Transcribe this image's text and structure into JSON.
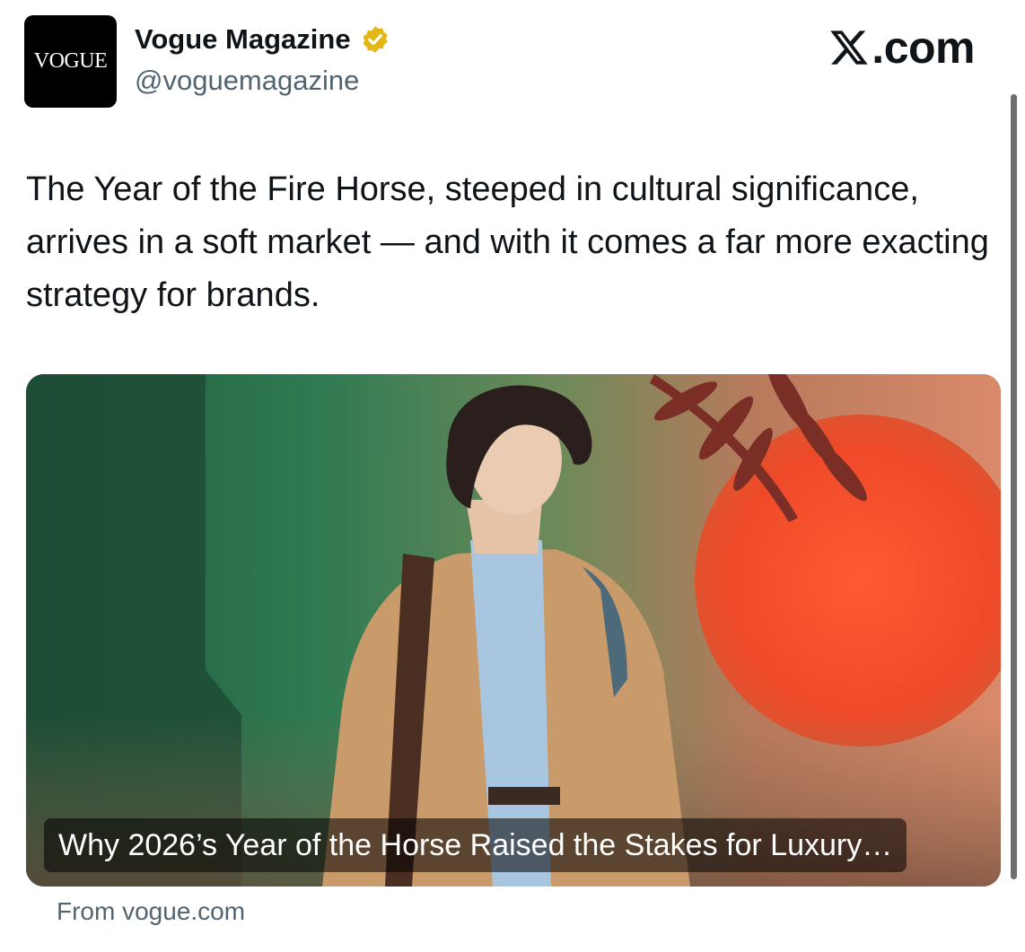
{
  "account": {
    "avatar_text": "VOGUE",
    "name": "Vogue Magazine",
    "handle": "@voguemagazine",
    "verified_badge": "gold-verified-check"
  },
  "site_label": ".com",
  "site_icon": "x-logo",
  "tweet": {
    "text": "The Year of the Fire Horse, steeped in cultural significance, arrives in a soft market — and with it comes a far more exacting strategy for brands."
  },
  "link_card": {
    "title": "Why 2026’s Year of the Horse Raised the Stakes for Luxury…",
    "source": "From vogue.com"
  },
  "colors": {
    "text_primary": "#0f1419",
    "text_secondary": "#536471",
    "verified_gold": "#e2b719",
    "card_green": "#2d6d4a",
    "card_orange": "#ee4a2a"
  }
}
